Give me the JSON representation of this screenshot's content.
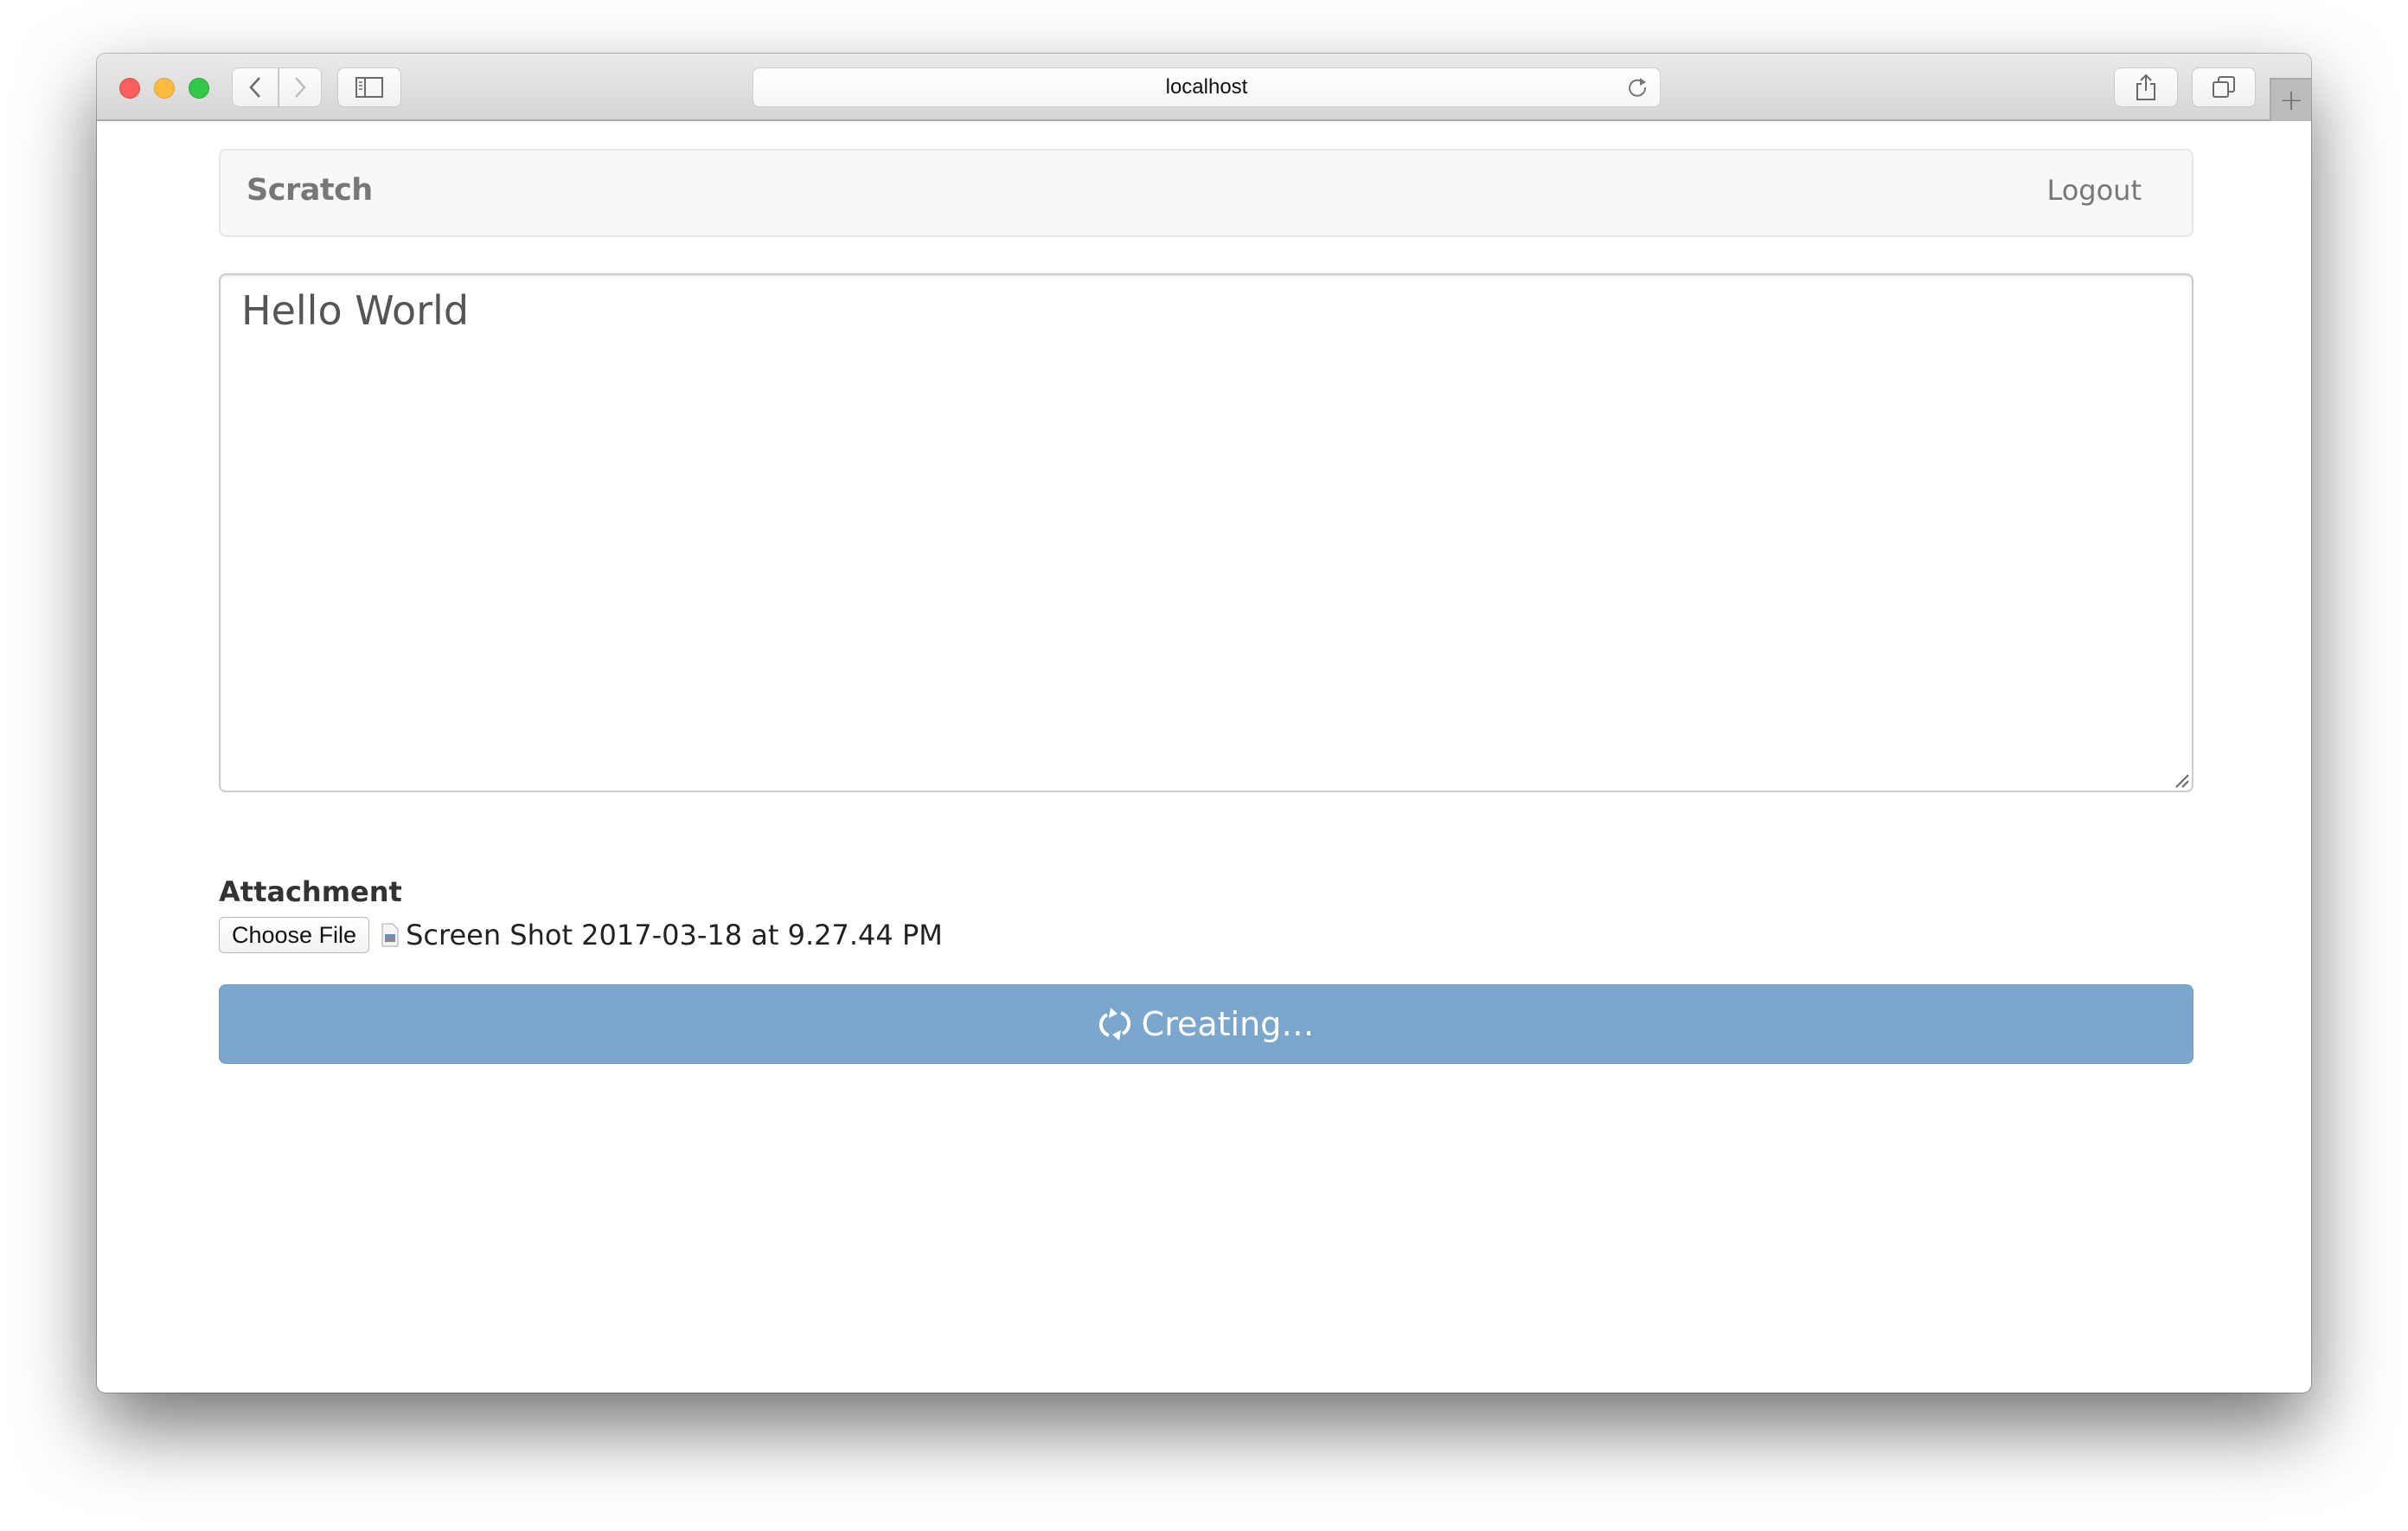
{
  "browser": {
    "url": "localhost",
    "icons": {
      "close": "traffic-close",
      "minimize": "traffic-minimize",
      "zoom": "traffic-zoom",
      "back": "chevron-left-icon",
      "forward": "chevron-right-icon",
      "sidebar": "sidebar-icon",
      "reload": "reload-icon",
      "share": "share-icon",
      "tabs": "tabs-icon",
      "new_tab": "+"
    }
  },
  "navbar": {
    "brand": "Scratch",
    "logout_label": "Logout"
  },
  "form": {
    "content_value": "Hello World",
    "attachment_label": "Attachment",
    "choose_file_label": "Choose File",
    "file_name": "Screen Shot 2017-03-18 at 9.27.44 PM",
    "submit_label": "Creating…",
    "submit_state": "loading",
    "submit_color": "#7ca7cd"
  }
}
